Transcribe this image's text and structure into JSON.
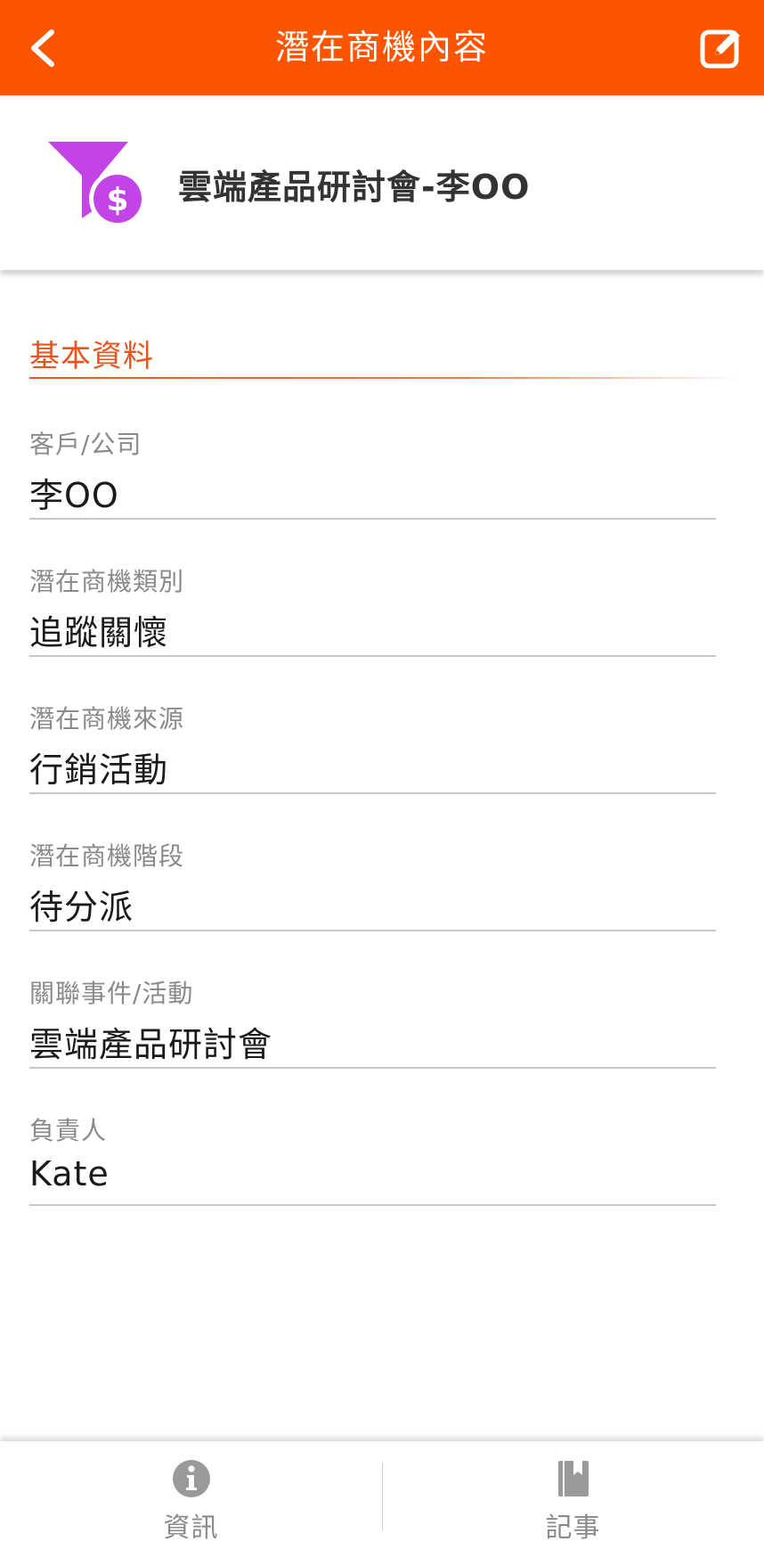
{
  "header": {
    "title": "潛在商機內容",
    "back_icon": "chevron-left-icon",
    "edit_icon": "edit-icon",
    "background_color": "#fd5400"
  },
  "record": {
    "title": "雲端產品研討會-李OO",
    "icon": "funnel-dollar-icon",
    "icon_color": "#c244e6"
  },
  "section": {
    "heading": "基本資料",
    "accent_color": "#e8531f"
  },
  "fields": [
    {
      "label": "客戶/公司",
      "value": "李OO"
    },
    {
      "label": "潛在商機類別",
      "value": "追蹤關懷"
    },
    {
      "label": "潛在商機來源",
      "value": "行銷活動"
    },
    {
      "label": "潛在商機階段",
      "value": "待分派"
    },
    {
      "label": "關聯事件/活動",
      "value": "雲端產品研討會"
    },
    {
      "label": "負責人",
      "value": "Kate"
    }
  ],
  "tabs": [
    {
      "label": "資訊",
      "icon": "info-icon"
    },
    {
      "label": "記事",
      "icon": "notebook-icon"
    }
  ]
}
